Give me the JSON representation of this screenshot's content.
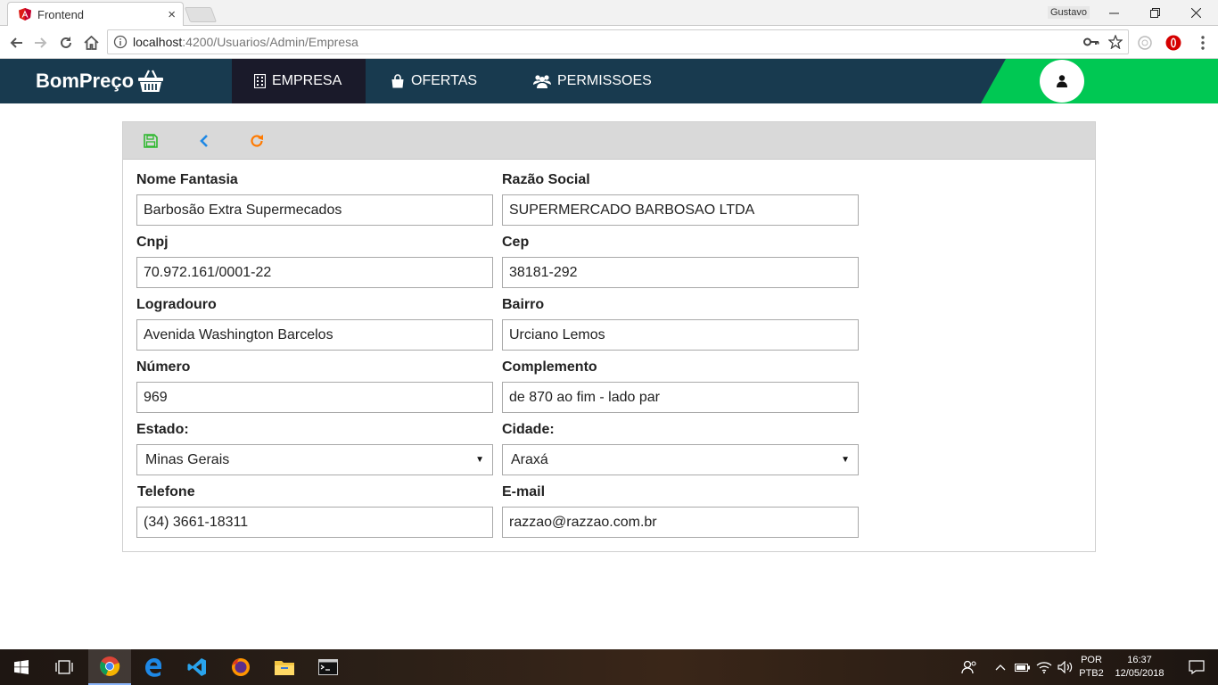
{
  "browser": {
    "tab_title": "Frontend",
    "tab_close": "×",
    "profile_name": "Gustavo",
    "url_host": "localhost",
    "url_path": ":4200/Usuarios/Admin/Empresa"
  },
  "app": {
    "brand": "BomPreço",
    "nav": [
      {
        "label": "EMPRESA",
        "icon": "building-icon",
        "active": true
      },
      {
        "label": "OFERTAS",
        "icon": "shopping-bag-icon",
        "active": false
      },
      {
        "label": "PERMISSOES",
        "icon": "users-icon",
        "active": false
      }
    ],
    "accent_green": "#00c853",
    "nav_bg": "#183a4f"
  },
  "toolbar": {
    "save_icon": "save-icon",
    "back_icon": "chevron-left-icon",
    "refresh_icon": "refresh-icon"
  },
  "form": {
    "nome_fantasia": {
      "label": "Nome Fantasia",
      "value": "Barbosão Extra Supermecados"
    },
    "razao_social": {
      "label": "Razão Social",
      "value": "SUPERMERCADO BARBOSAO LTDA"
    },
    "cnpj": {
      "label": "Cnpj",
      "value": "70.972.161/0001-22"
    },
    "cep": {
      "label": "Cep",
      "value": "38181-292"
    },
    "logradouro": {
      "label": "Logradouro",
      "value": "Avenida Washington Barcelos"
    },
    "bairro": {
      "label": "Bairro",
      "value": "Urciano Lemos"
    },
    "numero": {
      "label": "Número",
      "value": "969"
    },
    "complemento": {
      "label": "Complemento",
      "value": "de 870 ao fim - lado par"
    },
    "estado": {
      "label": "Estado:",
      "value": "Minas Gerais"
    },
    "cidade": {
      "label": "Cidade:",
      "value": "Araxá"
    },
    "telefone": {
      "label": "Telefone",
      "value": "(34) 3661-18311"
    },
    "email": {
      "label": "E-mail",
      "value": "razzao@razzao.com.br"
    }
  },
  "taskbar": {
    "lang_top": "POR",
    "lang_bottom": "PTB2",
    "time": "16:37",
    "date": "12/05/2018"
  }
}
